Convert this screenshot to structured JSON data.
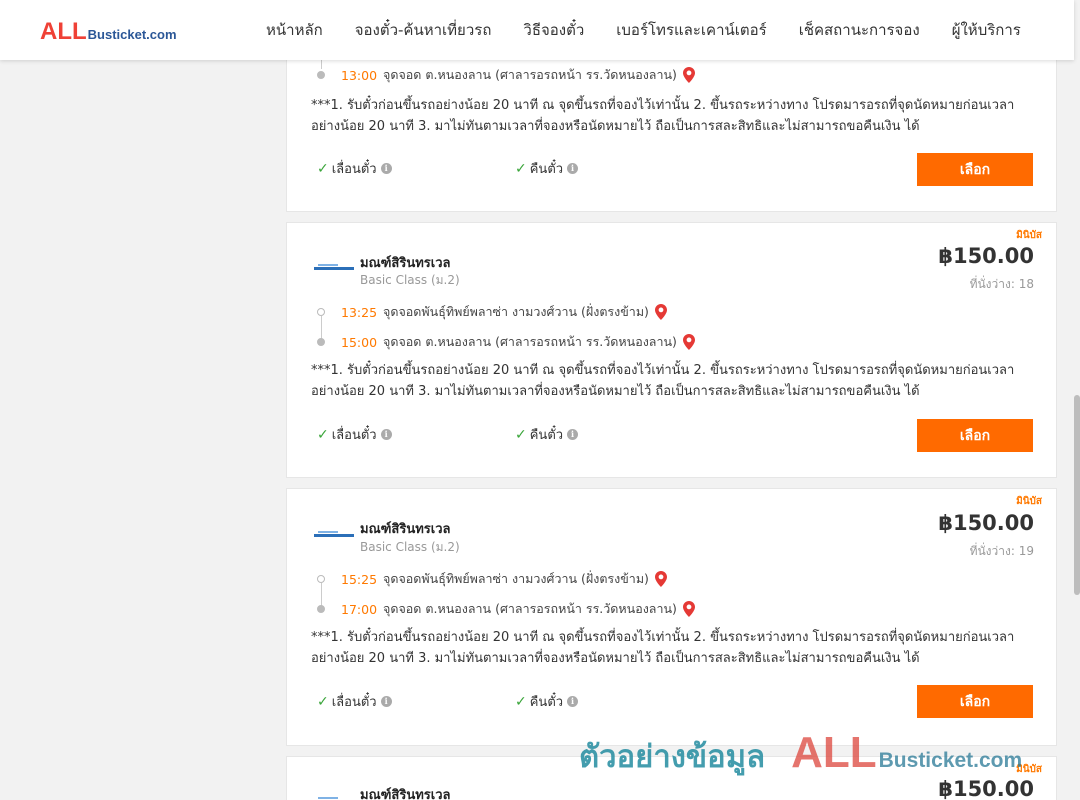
{
  "header": {
    "logo_all": "ALL",
    "logo_rest": "Busticket.com",
    "nav": [
      "หน้าหลัก",
      "จองตั๋ว-ค้นหาเที่ยวรถ",
      "วิธีจองตั๋ว",
      "เบอร์โทรและเคาน์เตอร์",
      "เช็คสถานะการจอง",
      "ผู้ให้บริการ"
    ]
  },
  "common": {
    "note": "***1. รับตั๋วก่อนขึ้นรถอย่างน้อย 20 นาที ณ จุดขึ้นรถที่จองไว้เท่านั้น 2. ขึ้นรถระหว่างทาง โปรดมารอรถที่จุดนัดหมายก่อนเวลาอย่างน้อย 20 นาที 3. มาไม่ทันตามเวลาที่จองหรือนัดหมายไว้ ถือเป็นการสละสิทธิและไม่สามารถขอคืนเงิน ได้",
    "feature_change": "เลื่อนตั๋ว",
    "feature_refund": "คืนตั๋ว",
    "select_label": "เลือก",
    "badge": "มินิบัส"
  },
  "cards": [
    {
      "arrive_time": "13:00",
      "arrive_place": "จุดจอด ต.หนองลาน (ศาลารอรถหน้า รร.วัดหนองลาน)"
    },
    {
      "operator": "มณฑ์สิรินทรเวล",
      "class": "Basic Class (ม.2)",
      "price": "฿150.00",
      "seats": "ที่นั่งว่าง: 18",
      "depart_time": "13:25",
      "depart_place": "จุดจอดพันธุ์ทิพย์พลาซ่า งามวงศ์วาน (ฝั่งตรงข้าม)",
      "arrive_time": "15:00",
      "arrive_place": "จุดจอด ต.หนองลาน (ศาลารอรถหน้า รร.วัดหนองลาน)"
    },
    {
      "operator": "มณฑ์สิรินทรเวล",
      "class": "Basic Class (ม.2)",
      "price": "฿150.00",
      "seats": "ที่นั่งว่าง: 19",
      "depart_time": "15:25",
      "depart_place": "จุดจอดพันธุ์ทิพย์พลาซ่า งามวงศ์วาน (ฝั่งตรงข้าม)",
      "arrive_time": "17:00",
      "arrive_place": "จุดจอด ต.หนองลาน (ศาลารอรถหน้า รร.วัดหนองลาน)"
    },
    {
      "operator": "มณฑ์สิรินทรเวล",
      "price": "฿150.00"
    }
  ],
  "watermark": {
    "thai": "ตัวอย่างข้อมูล",
    "all": "ALL",
    "rest": "Busticket.com"
  },
  "colors": {
    "accent": "#ff6a00",
    "time": "#ff7900",
    "check": "#3aa53a",
    "pin": "#e53935"
  }
}
